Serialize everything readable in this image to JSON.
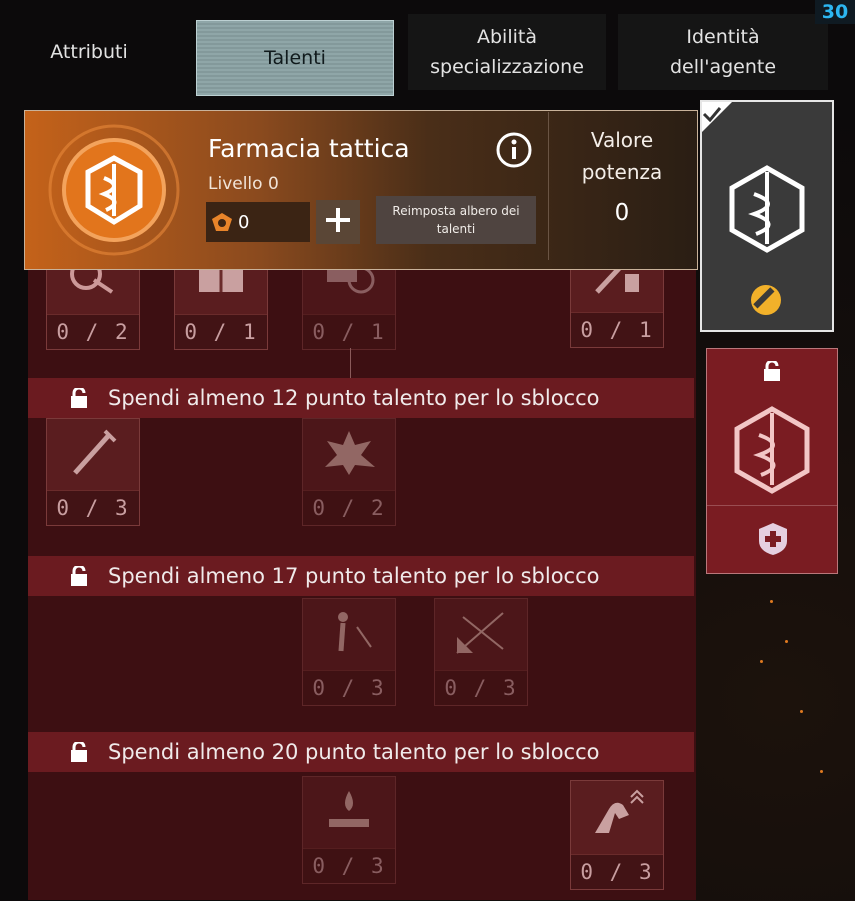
{
  "corner_badge": "30",
  "tabs": [
    {
      "label": "Attributi"
    },
    {
      "label": "Talenti"
    },
    {
      "label": "Abilità specializzazione"
    },
    {
      "label": "Identità dell'agente"
    }
  ],
  "header": {
    "title": "Farmacia tattica",
    "level": "Livello 0",
    "points": "0",
    "reset_label": "Reimposta albero dei talenti",
    "power_label": "Valore potenza",
    "power_value": "0"
  },
  "tree": {
    "tier1": [
      "0 / 2",
      "0 / 1",
      "0 / 1",
      "0 / 1"
    ],
    "lock1": "Spendi almeno 12 punto talento per lo sblocco",
    "tier2": [
      "0 / 3",
      "0 / 2"
    ],
    "lock2": "Spendi almeno 17 punto talento per lo sblocco",
    "tier3": [
      "0 / 3",
      "0 / 3"
    ],
    "lock3": "Spendi almeno 20 punto talento per lo sblocco",
    "tier4": [
      "0 / 3",
      "0 / 3"
    ]
  },
  "colors": {
    "accent_orange": "#d4701c",
    "locked_red": "#6b1b20",
    "corner_blue": "#2cb6f1"
  },
  "icons": [
    "info-icon",
    "plus-icon",
    "lock-icon",
    "caduceus-icon",
    "wrench-gear-icon",
    "shield-cross-icon",
    "check-icon"
  ]
}
